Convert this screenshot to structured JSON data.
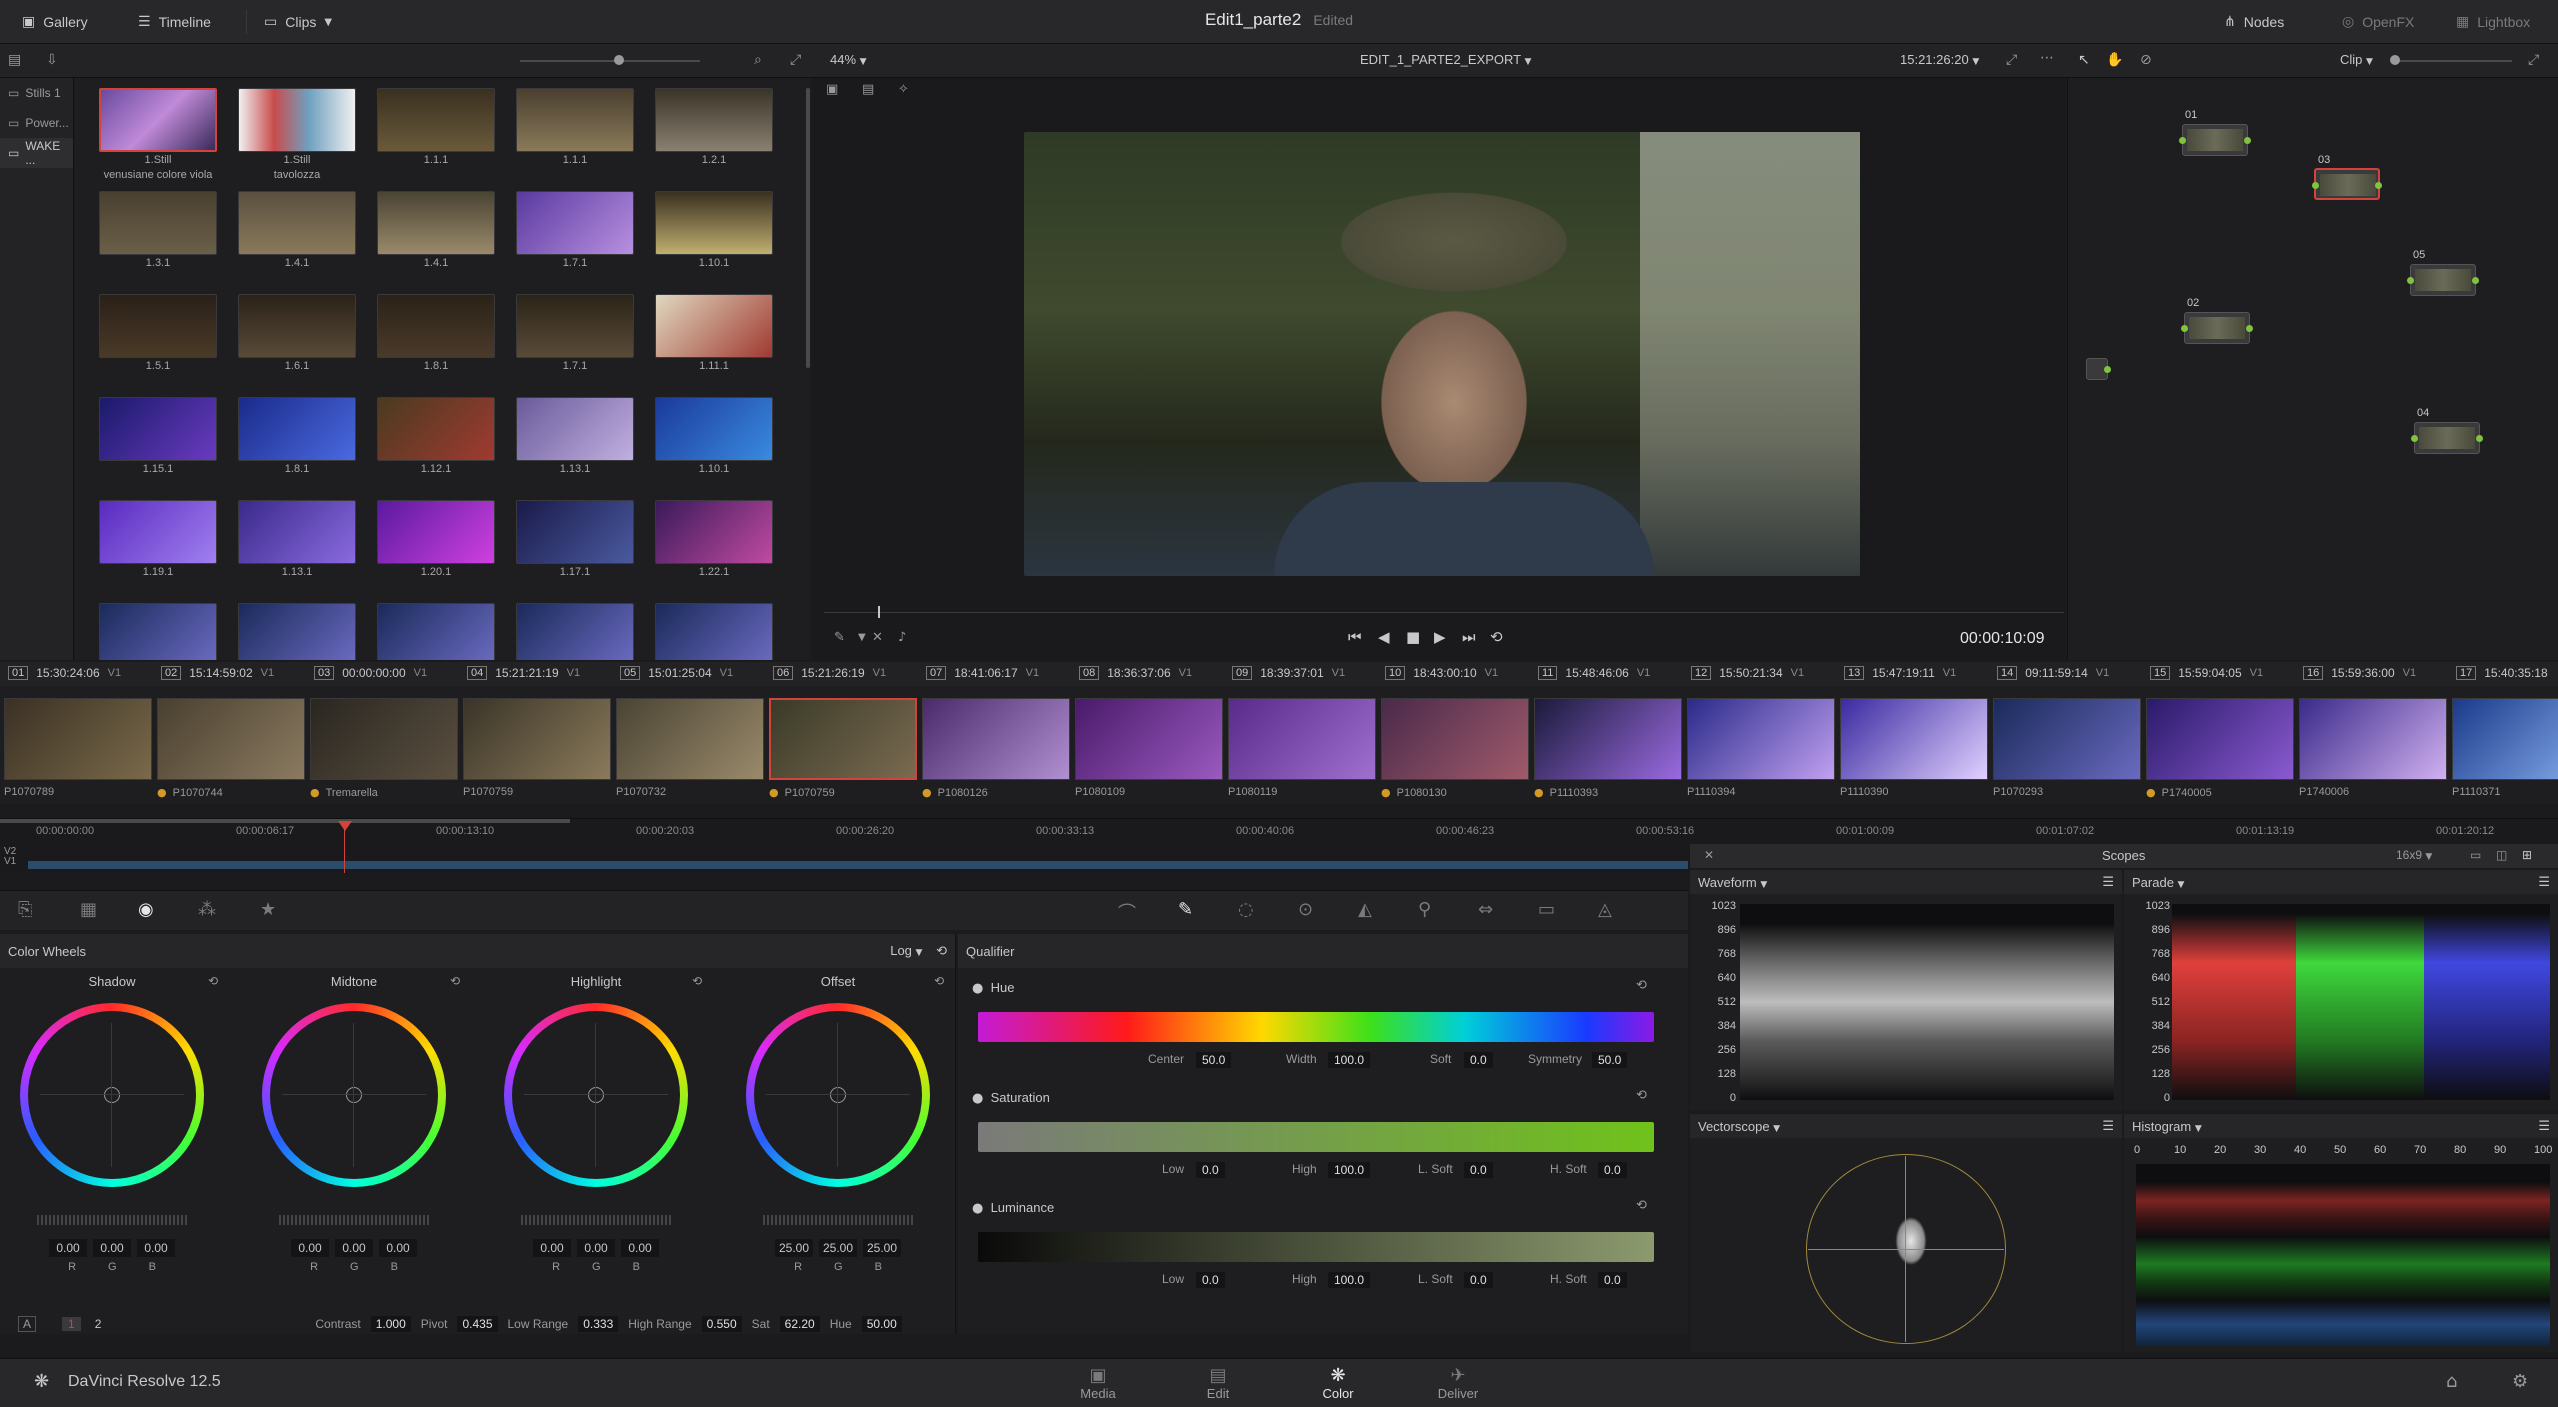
{
  "topbar": {
    "gallery": "Gallery",
    "timeline": "Timeline",
    "clips": "Clips",
    "project": "Edit1_parte2",
    "project_status": "Edited",
    "nodes": "Nodes",
    "openfx": "OpenFX",
    "lightbox": "Lightbox"
  },
  "viewer": {
    "zoom": "44%",
    "timeline_name": "EDIT_1_PARTE2_EXPORT",
    "source_tc": "15:21:26:20",
    "clip_mode": "Clip",
    "playhead_tc": "00:00:10:09"
  },
  "albums": [
    "Stills 1",
    "Power...",
    "WAKE ..."
  ],
  "stills": [
    {
      "label": "1.Still\nvenusiane colore viola"
    },
    {
      "label": "1.Still\ntavolozza"
    },
    {
      "label": "1.1.1"
    },
    {
      "label": "1.1.1"
    },
    {
      "label": "1.2.1"
    },
    {
      "label": "1.3.1"
    },
    {
      "label": "1.4.1"
    },
    {
      "label": "1.4.1"
    },
    {
      "label": "1.7.1"
    },
    {
      "label": "1.10.1"
    },
    {
      "label": "1.5.1"
    },
    {
      "label": "1.6.1"
    },
    {
      "label": "1.8.1"
    },
    {
      "label": "1.7.1"
    },
    {
      "label": "1.11.1"
    },
    {
      "label": "1.15.1"
    },
    {
      "label": "1.8.1"
    },
    {
      "label": "1.12.1"
    },
    {
      "label": "1.13.1"
    },
    {
      "label": "1.10.1"
    },
    {
      "label": "1.19.1"
    },
    {
      "label": "1.13.1"
    },
    {
      "label": "1.20.1"
    },
    {
      "label": "1.17.1"
    },
    {
      "label": "1.22.1"
    }
  ],
  "nodes": [
    {
      "num": "01"
    },
    {
      "num": "02"
    },
    {
      "num": "03"
    },
    {
      "num": "04"
    },
    {
      "num": "05"
    }
  ],
  "clips": [
    {
      "n": "01",
      "tc": "15:30:24:06",
      "v": "V1",
      "name": "P1070789",
      "dot": false
    },
    {
      "n": "02",
      "tc": "15:14:59:02",
      "v": "V1",
      "name": "P1070744",
      "dot": true
    },
    {
      "n": "03",
      "tc": "00:00:00:00",
      "v": "V1",
      "name": "Tremarella",
      "dot": true
    },
    {
      "n": "04",
      "tc": "15:21:21:19",
      "v": "V1",
      "name": "P1070759",
      "dot": false
    },
    {
      "n": "05",
      "tc": "15:01:25:04",
      "v": "V1",
      "name": "P1070732",
      "dot": false
    },
    {
      "n": "06",
      "tc": "15:21:26:19",
      "v": "V1",
      "name": "P1070759",
      "dot": true
    },
    {
      "n": "07",
      "tc": "18:41:06:17",
      "v": "V1",
      "name": "P1080126",
      "dot": true
    },
    {
      "n": "08",
      "tc": "18:36:37:06",
      "v": "V1",
      "name": "P1080109",
      "dot": false
    },
    {
      "n": "09",
      "tc": "18:39:37:01",
      "v": "V1",
      "name": "P1080119",
      "dot": false
    },
    {
      "n": "10",
      "tc": "18:43:00:10",
      "v": "V1",
      "name": "P1080130",
      "dot": true
    },
    {
      "n": "11",
      "tc": "15:48:46:06",
      "v": "V1",
      "name": "P1110393",
      "dot": true
    },
    {
      "n": "12",
      "tc": "15:50:21:34",
      "v": "V1",
      "name": "P1110394",
      "dot": false
    },
    {
      "n": "13",
      "tc": "15:47:19:11",
      "v": "V1",
      "name": "P1110390",
      "dot": false
    },
    {
      "n": "14",
      "tc": "09:11:59:14",
      "v": "V1",
      "name": "P1070293",
      "dot": false
    },
    {
      "n": "15",
      "tc": "15:59:04:05",
      "v": "V1",
      "name": "P1740005",
      "dot": true
    },
    {
      "n": "16",
      "tc": "15:59:36:00",
      "v": "V1",
      "name": "P1740006",
      "dot": false
    },
    {
      "n": "17",
      "tc": "15:40:35:18",
      "v": "",
      "name": "P1110371",
      "dot": false
    }
  ],
  "mini_timeline": {
    "tracks": [
      "V2",
      "V1"
    ],
    "ticks": [
      "00:00:00:00",
      "00:00:06:17",
      "00:00:13:10",
      "00:00:20:03",
      "00:00:26:20",
      "00:00:33:13",
      "00:00:40:06",
      "00:00:46:23",
      "00:00:53:16",
      "00:01:00:09",
      "00:01:07:02",
      "00:01:13:19",
      "00:01:20:12"
    ]
  },
  "color_wheels": {
    "title": "Color Wheels",
    "mode": "Log",
    "wheels": [
      {
        "name": "Shadow",
        "r": "0.00",
        "g": "0.00",
        "b": "0.00"
      },
      {
        "name": "Midtone",
        "r": "0.00",
        "g": "0.00",
        "b": "0.00"
      },
      {
        "name": "Highlight",
        "r": "0.00",
        "g": "0.00",
        "b": "0.00"
      },
      {
        "name": "Offset",
        "r": "25.00",
        "g": "25.00",
        "b": "25.00"
      }
    ],
    "rgb_labels": [
      "R",
      "G",
      "B"
    ],
    "page_a": "A",
    "page_1": "1",
    "page_2": "2",
    "contrast_label": "Contrast",
    "contrast": "1.000",
    "pivot_label": "Pivot",
    "pivot": "0.435",
    "low_range_label": "Low Range",
    "low_range": "0.333",
    "high_range_label": "High Range",
    "high_range": "0.550",
    "sat_label": "Sat",
    "sat": "62.20",
    "hue_label": "Hue",
    "hue": "50.00"
  },
  "qualifier": {
    "title": "Qualifier",
    "hue": {
      "label": "Hue",
      "center_l": "Center",
      "center": "50.0",
      "width_l": "Width",
      "width": "100.0",
      "soft_l": "Soft",
      "soft": "0.0",
      "sym_l": "Symmetry",
      "sym": "50.0"
    },
    "sat": {
      "label": "Saturation",
      "low_l": "Low",
      "low": "0.0",
      "high_l": "High",
      "high": "100.0",
      "lsoft_l": "L. Soft",
      "lsoft": "0.0",
      "hsoft_l": "H. Soft",
      "hsoft": "0.0"
    },
    "lum": {
      "label": "Luminance",
      "low_l": "Low",
      "low": "0.0",
      "high_l": "High",
      "high": "100.0",
      "lsoft_l": "L. Soft",
      "lsoft": "0.0",
      "hsoft_l": "H. Soft",
      "hsoft": "0.0"
    }
  },
  "scopes": {
    "title": "Scopes",
    "layout": "16x9",
    "waveform": "Waveform",
    "parade": "Parade",
    "vectorscope": "Vectorscope",
    "histogram": "Histogram",
    "y_ticks": [
      "1023",
      "896",
      "768",
      "640",
      "512",
      "384",
      "256",
      "128",
      "0"
    ],
    "hist_ticks": [
      "0",
      "10",
      "20",
      "30",
      "40",
      "50",
      "60",
      "70",
      "80",
      "90",
      "100"
    ]
  },
  "status": {
    "app": "DaVinci Resolve 12.5",
    "pages": [
      "Media",
      "Edit",
      "Color",
      "Deliver"
    ],
    "active_page": "Color"
  },
  "colors": {
    "accent_red": "#d2433b",
    "node_green": "#7fc43c",
    "timeline_blue": "#2c4c6c"
  }
}
